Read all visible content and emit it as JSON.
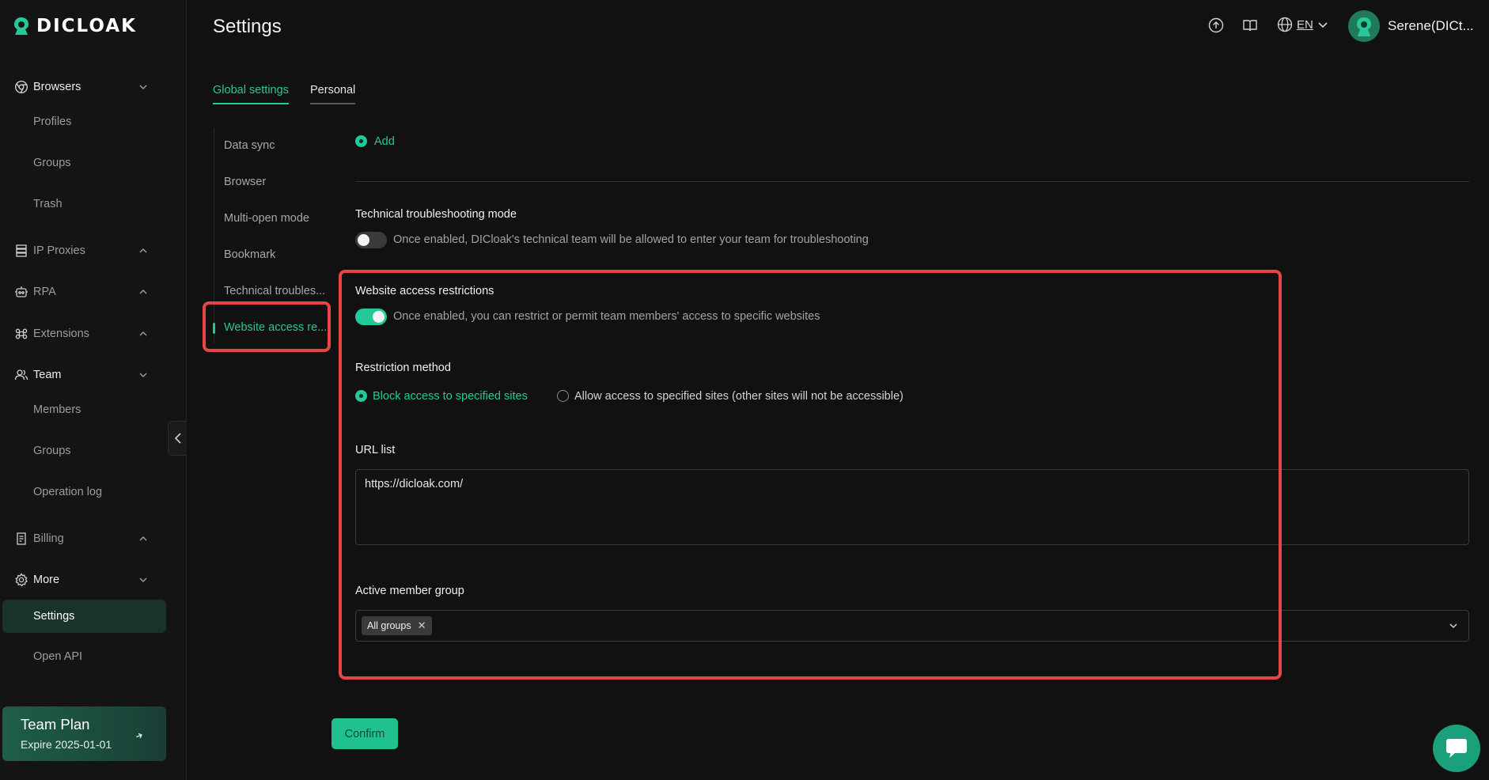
{
  "app": {
    "logo_text": "DICLOAK",
    "page_title": "Settings"
  },
  "colors": {
    "accent": "#24c99a",
    "highlight": "#e84545",
    "background": "#111111"
  },
  "sidebar": {
    "browsers": {
      "label": "Browsers",
      "items": [
        "Profiles",
        "Groups",
        "Trash"
      ]
    },
    "ip_proxies": {
      "label": "IP Proxies"
    },
    "rpa": {
      "label": "RPA"
    },
    "extensions": {
      "label": "Extensions"
    },
    "team": {
      "label": "Team",
      "items": [
        "Members",
        "Groups",
        "Operation log"
      ]
    },
    "billing": {
      "label": "Billing"
    },
    "more": {
      "label": "More",
      "items": [
        "Settings",
        "Open API"
      ]
    },
    "plan": {
      "title": "Team Plan",
      "expire": "Expire 2025-01-01"
    }
  },
  "header": {
    "language": "EN",
    "user_name": "Serene(DICt..."
  },
  "tabs": [
    "Global settings",
    "Personal"
  ],
  "settings_nav": [
    "Data sync",
    "Browser",
    "Multi-open mode",
    "Bookmark",
    "Technical troubles...",
    "Website access re..."
  ],
  "content": {
    "add_label": "Add",
    "troubleshooting": {
      "title": "Technical troubleshooting mode",
      "desc": "Once enabled, DICloak's technical team will be allowed to enter your team for troubleshooting",
      "enabled": false
    },
    "website_access": {
      "title": "Website access restrictions",
      "desc": "Once enabled, you can restrict or permit team members' access to specific websites",
      "enabled": true
    },
    "restriction": {
      "title": "Restriction method",
      "option_block": "Block access to specified sites",
      "option_allow": "Allow access to specified sites (other sites will not be accessible)",
      "selected": "block"
    },
    "url_list": {
      "title": "URL list",
      "value": "https://dicloak.com/"
    },
    "member_group": {
      "title": "Active member group",
      "tag": "All groups"
    },
    "confirm_label": "Confirm"
  }
}
